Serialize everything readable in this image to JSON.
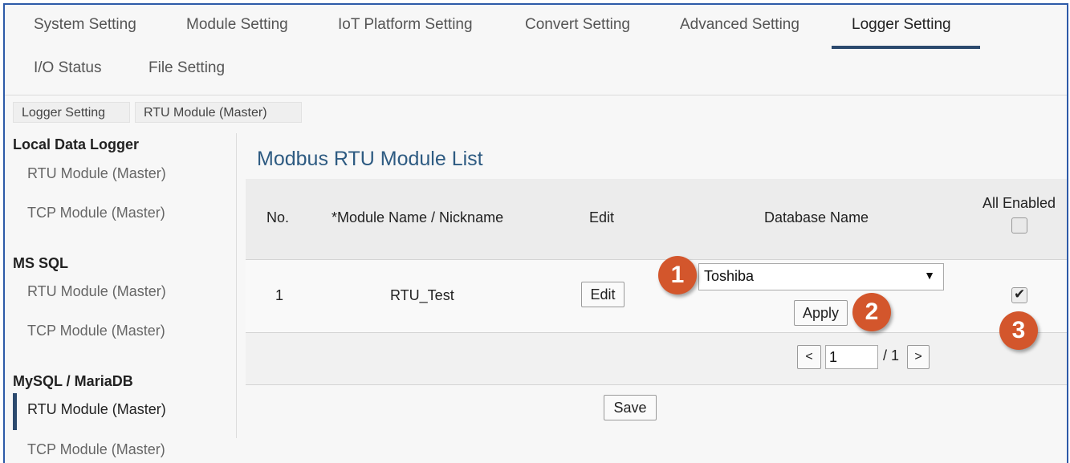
{
  "tabs": [
    {
      "label": "System Setting"
    },
    {
      "label": "Module Setting"
    },
    {
      "label": "IoT Platform Setting"
    },
    {
      "label": "Convert Setting"
    },
    {
      "label": "Advanced Setting"
    },
    {
      "label": "Logger Setting",
      "active": true
    },
    {
      "label": "I/O Status"
    },
    {
      "label": "File Setting"
    }
  ],
  "breadcrumb": [
    "Logger Setting",
    "RTU Module (Master)"
  ],
  "sidebar": {
    "groups": [
      {
        "title": "Local Data Logger",
        "items": [
          "RTU Module (Master)",
          "TCP Module (Master)"
        ]
      },
      {
        "title": "MS SQL",
        "items": [
          "RTU Module (Master)",
          "TCP Module (Master)"
        ]
      },
      {
        "title": "MySQL / MariaDB",
        "items": [
          "RTU Module (Master)",
          "TCP Module (Master)"
        ]
      }
    ],
    "active_item": "MySQL / MariaDB > RTU Module (Master)"
  },
  "main": {
    "title": "Modbus RTU Module List",
    "columns": {
      "no": "No.",
      "name": "*Module Name / Nickname",
      "edit": "Edit",
      "db": "Database Name",
      "enabled": "All Enabled"
    },
    "all_enabled_checked": false,
    "rows": [
      {
        "no": "1",
        "name": "RTU_Test",
        "edit_label": "Edit",
        "database": "Toshiba",
        "apply_label": "Apply",
        "enabled": true
      }
    ],
    "pagination": {
      "prev": "<",
      "page": "1",
      "total": "/ 1",
      "next": ">"
    },
    "save_label": "Save"
  },
  "callouts": [
    "1",
    "2",
    "3"
  ],
  "colors": {
    "accent": "#2c4a6e",
    "title": "#2e5b82",
    "callout": "#d3562c",
    "frame": "#2d5aa8"
  }
}
